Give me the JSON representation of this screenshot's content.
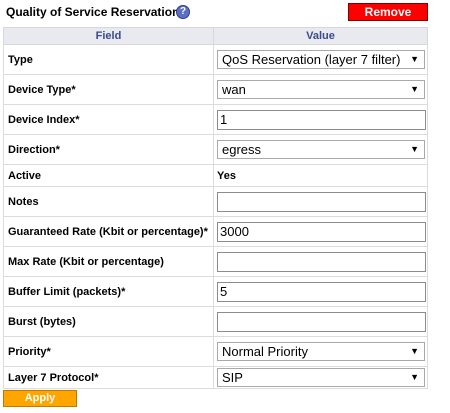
{
  "header": {
    "title": "Quality of Service Reservations",
    "help_icon": "?",
    "remove_label": "Remove"
  },
  "table": {
    "col_field": "Field",
    "col_value": "Value"
  },
  "fields": {
    "type": {
      "label": "Type",
      "value": "QoS Reservation (layer 7 filter)"
    },
    "device_type": {
      "label": "Device Type*",
      "value": "wan"
    },
    "device_index": {
      "label": "Device Index*",
      "value": "1"
    },
    "direction": {
      "label": "Direction*",
      "value": "egress"
    },
    "active": {
      "label": "Active",
      "value": "Yes"
    },
    "notes": {
      "label": "Notes",
      "value": ""
    },
    "guaranteed_rate": {
      "label": "Guaranteed Rate (Kbit or percentage)*",
      "value": "3000"
    },
    "max_rate": {
      "label": "Max Rate (Kbit or percentage)",
      "value": ""
    },
    "buffer_limit": {
      "label": "Buffer Limit (packets)*",
      "value": "5"
    },
    "burst": {
      "label": "Burst (bytes)",
      "value": ""
    },
    "priority": {
      "label": "Priority*",
      "value": "Normal Priority"
    },
    "layer7_protocol": {
      "label": "Layer 7 Protocol*",
      "value": "SIP"
    }
  },
  "apply_label": "Apply",
  "colors": {
    "remove": "#ff0000",
    "apply": "#ffa500",
    "header_bg": "#e8eaf0",
    "header_text": "#3a4a8a"
  },
  "icons": {
    "dropdown": "chevron-down-icon",
    "help": "help-icon"
  }
}
